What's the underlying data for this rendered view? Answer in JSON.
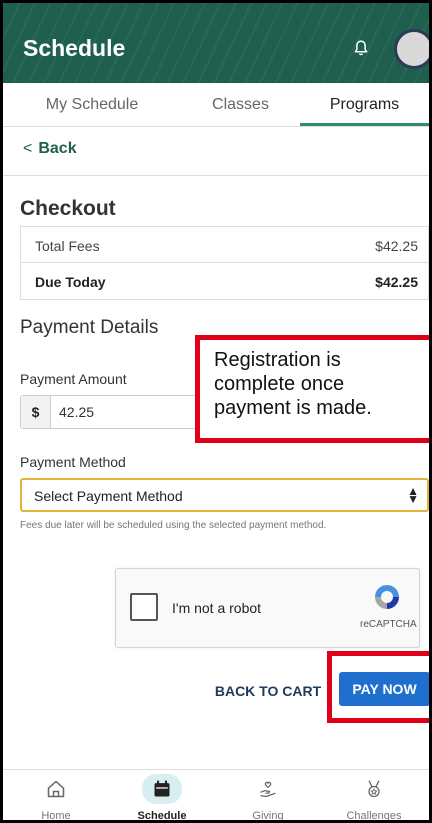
{
  "header": {
    "title": "Schedule",
    "bell_icon": "bell-icon",
    "avatar_icon": "avatar-icon"
  },
  "tabs": [
    {
      "label": "My Schedule",
      "active": false
    },
    {
      "label": "Classes",
      "active": false
    },
    {
      "label": "Programs",
      "active": true
    }
  ],
  "back": {
    "label": "Back",
    "icon": "chevron-left-icon"
  },
  "checkout": {
    "title": "Checkout",
    "rows": [
      {
        "label": "Total Fees",
        "value": "$42.25"
      },
      {
        "label": "Due Today",
        "value": "$42.25"
      }
    ]
  },
  "payment": {
    "title": "Payment Details",
    "amount_label": "Payment Amount",
    "amount_prefix": "$",
    "amount_value": "42.25",
    "method_label": "Payment Method",
    "method_selected": "Select Payment Method",
    "fees_note": "Fees due later will be scheduled using the selected payment method."
  },
  "callout": {
    "text": "Registration is complete once payment is made."
  },
  "recaptcha": {
    "label": "I'm not a robot",
    "brand": "reCAPTCHA"
  },
  "actions": {
    "back_to_cart": "BACK TO CART",
    "pay_now": "PAY NOW"
  },
  "bottom_nav": [
    {
      "label": "Home",
      "icon": "home-icon",
      "active": false
    },
    {
      "label": "Schedule",
      "icon": "calendar-icon",
      "active": true
    },
    {
      "label": "Giving",
      "icon": "giving-hand-icon",
      "active": false
    },
    {
      "label": "Challenges",
      "icon": "medal-icon",
      "active": false
    }
  ],
  "colors": {
    "header_bg": "#1f5f4e",
    "accent": "#2e8b74",
    "primary_button": "#1f6fcf",
    "highlight": "#e0001a",
    "select_border": "#e0b43a"
  }
}
